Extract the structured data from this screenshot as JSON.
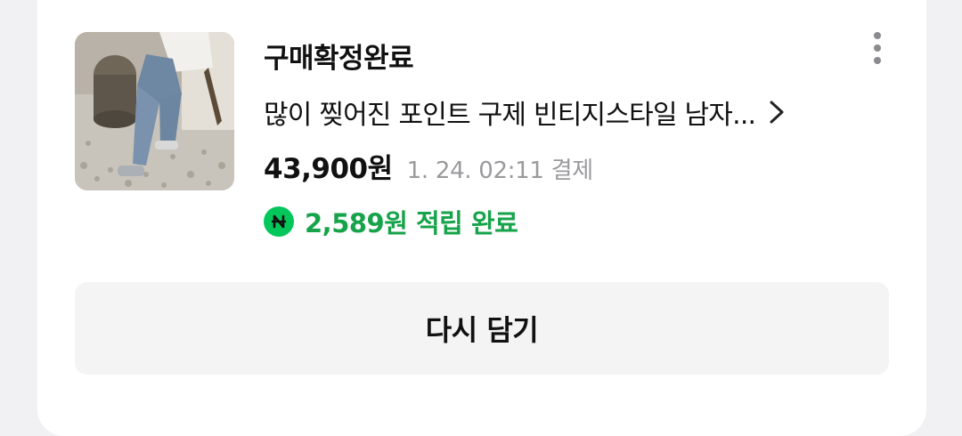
{
  "order": {
    "status": "구매확정완료",
    "product_title": "많이 찢어진 포인트 구제 빈티지스타일 남자...",
    "price": "43,900원",
    "payment_time": "1. 24. 02:11 결제",
    "points_text": "2,589원 적립 완료",
    "points_icon": "npay-point-icon",
    "points_color": "#16a34a",
    "icon_color": "#03c75a"
  },
  "actions": {
    "reorder_label": "다시 담기",
    "more_icon": "more-vertical-icon",
    "detail_icon": "chevron-right-icon"
  }
}
